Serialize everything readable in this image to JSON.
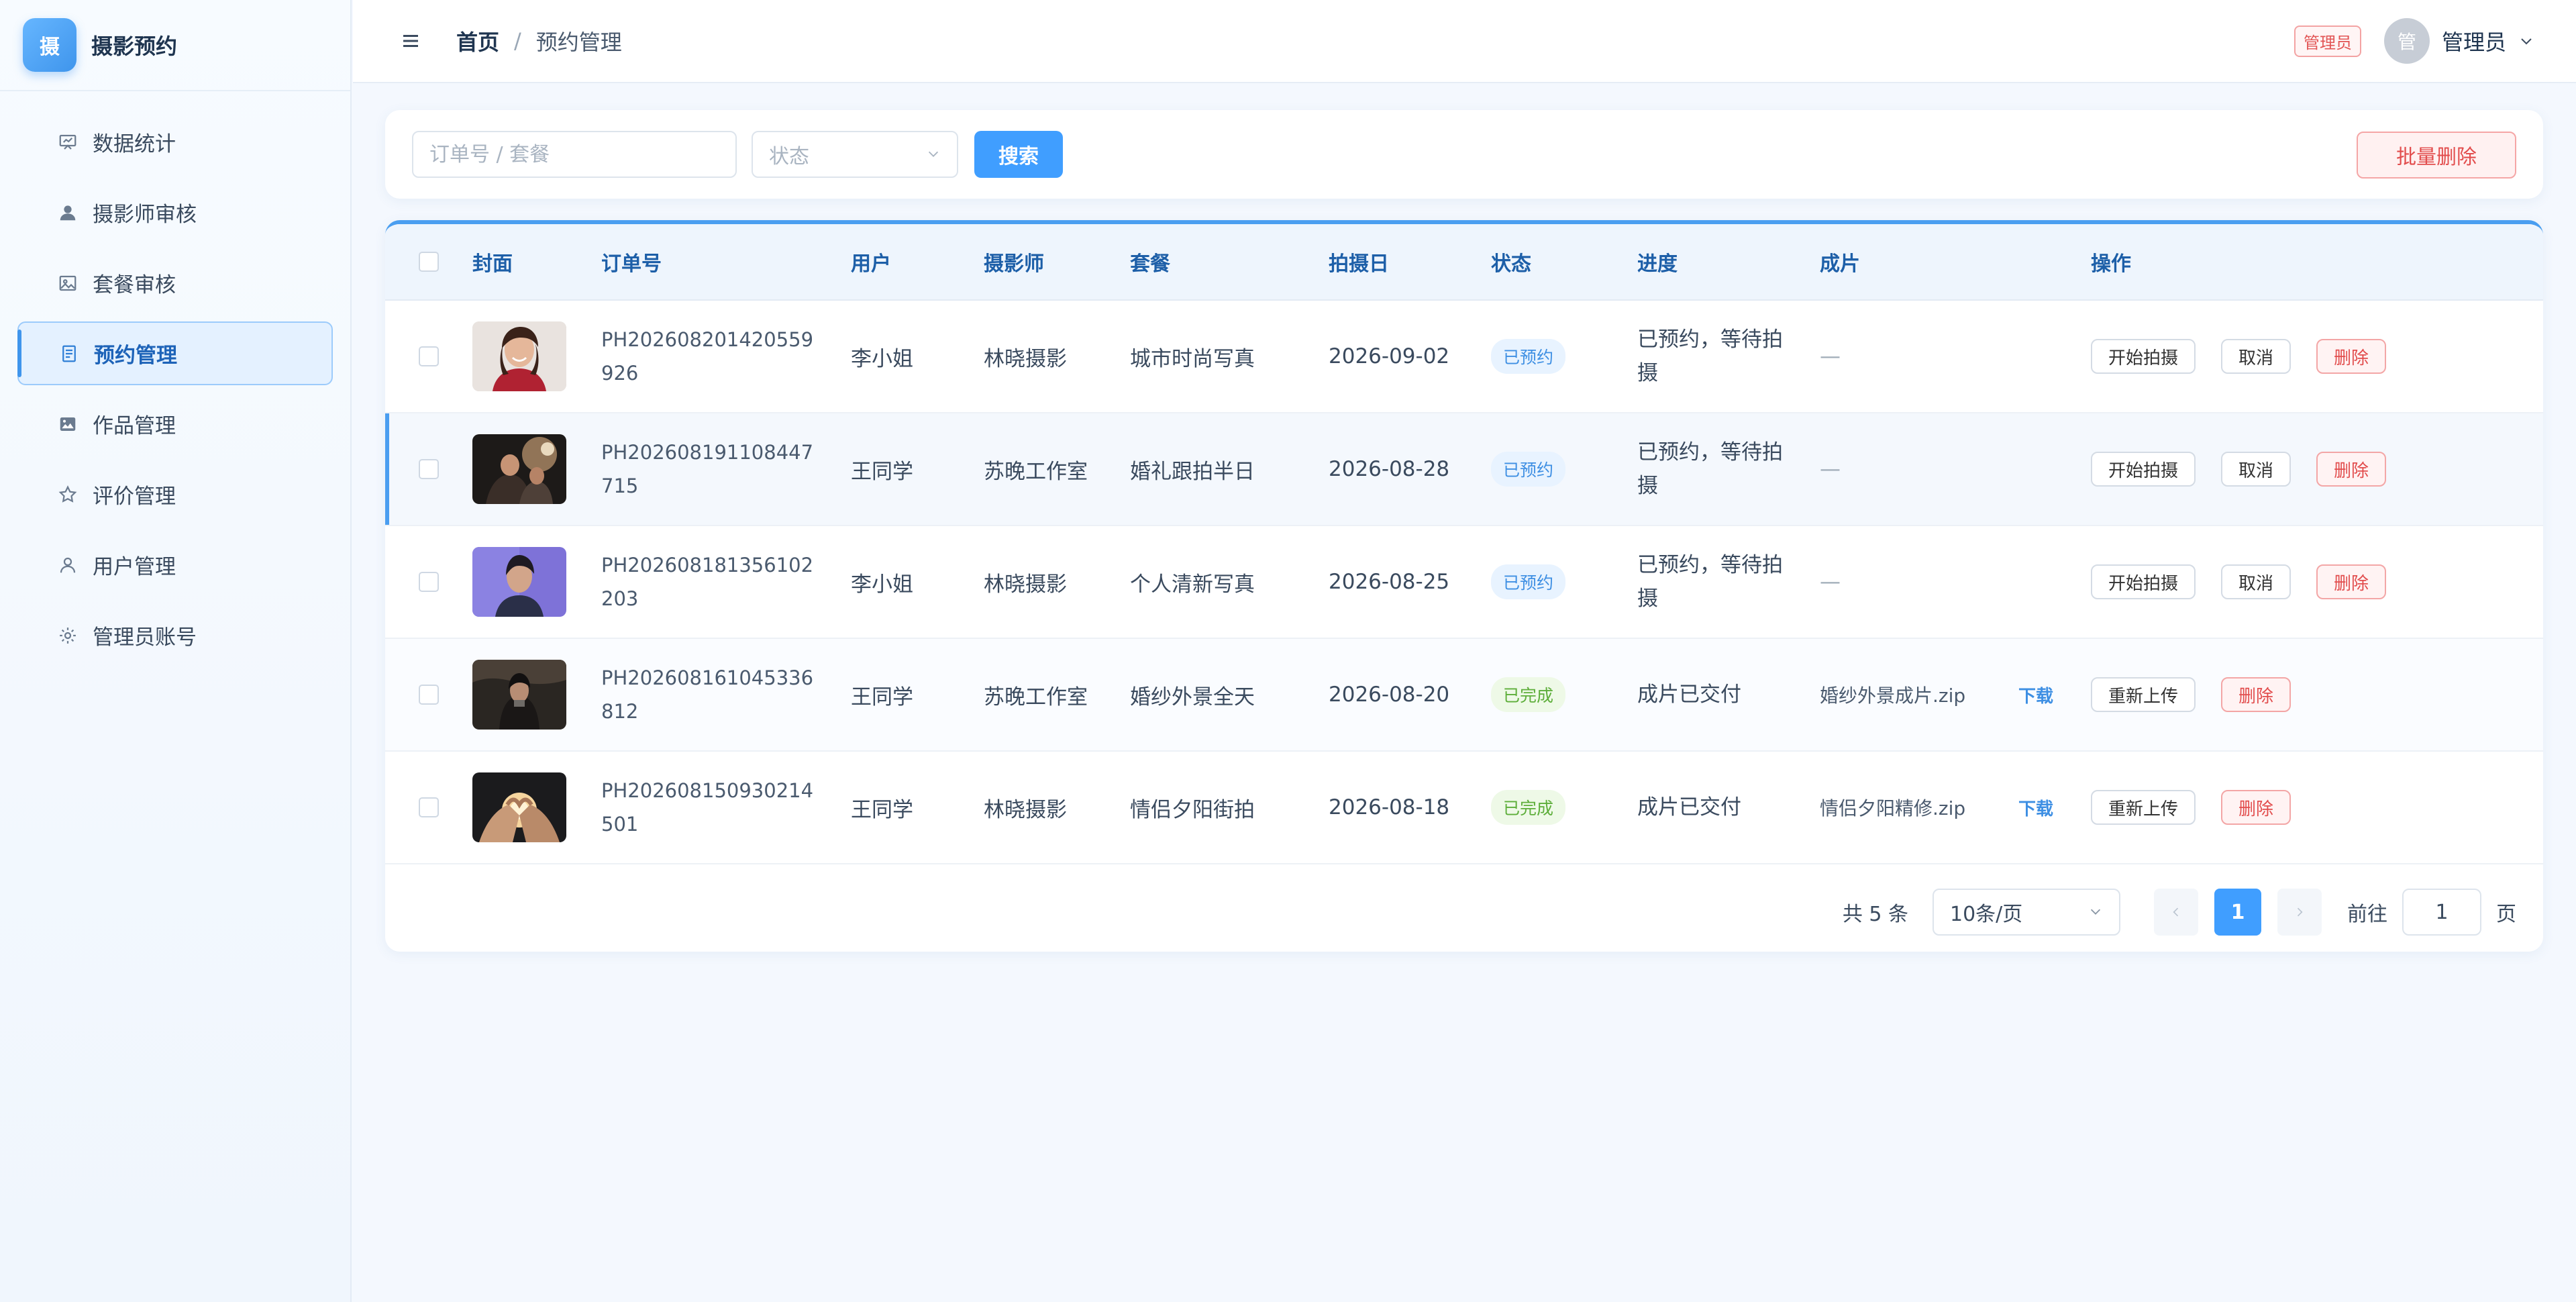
{
  "brand": {
    "logo_char": "摄",
    "name": "摄影预约"
  },
  "sidebar": {
    "items": [
      {
        "label": "数据统计",
        "icon": "chart-board-icon"
      },
      {
        "label": "摄影师审核",
        "icon": "person-icon"
      },
      {
        "label": "套餐审核",
        "icon": "image-icon"
      },
      {
        "label": "预约管理",
        "icon": "document-icon",
        "active": true
      },
      {
        "label": "作品管理",
        "icon": "gallery-icon"
      },
      {
        "label": "评价管理",
        "icon": "star-icon"
      },
      {
        "label": "用户管理",
        "icon": "user-icon"
      },
      {
        "label": "管理员账号",
        "icon": "gear-icon"
      }
    ]
  },
  "header": {
    "breadcrumb_home": "首页",
    "breadcrumb_sep": "/",
    "breadcrumb_current": "预约管理",
    "role_badge": "管理员",
    "avatar_char": "管",
    "user_name": "管理员"
  },
  "filters": {
    "search_placeholder": "订单号 / 套餐",
    "search_value": "",
    "status_placeholder": "状态",
    "search_button": "搜索",
    "batch_delete_button": "批量删除"
  },
  "table": {
    "columns": [
      "封面",
      "订单号",
      "用户",
      "摄影师",
      "套餐",
      "拍摄日",
      "状态",
      "进度",
      "成片",
      "操作"
    ],
    "rows": [
      {
        "order_no": "PH202608201420559926",
        "user": "李小姐",
        "photographer": "林晓摄影",
        "package": "城市时尚写真",
        "date": "2026-09-02",
        "status": "已预约",
        "progress": "已预约，等待拍摄",
        "result": "—",
        "download": "",
        "ops": [
          "开始拍摄",
          "取消",
          "删除"
        ]
      },
      {
        "order_no": "PH202608191108447715",
        "user": "王同学",
        "photographer": "苏晚工作室",
        "package": "婚礼跟拍半日",
        "date": "2026-08-28",
        "status": "已预约",
        "progress": "已预约，等待拍摄",
        "result": "—",
        "download": "",
        "ops": [
          "开始拍摄",
          "取消",
          "删除"
        ]
      },
      {
        "order_no": "PH202608181356102203",
        "user": "李小姐",
        "photographer": "林晓摄影",
        "package": "个人清新写真",
        "date": "2026-08-25",
        "status": "已预约",
        "progress": "已预约，等待拍摄",
        "result": "—",
        "download": "",
        "ops": [
          "开始拍摄",
          "取消",
          "删除"
        ]
      },
      {
        "order_no": "PH202608161045336812",
        "user": "王同学",
        "photographer": "苏晚工作室",
        "package": "婚纱外景全天",
        "date": "2026-08-20",
        "status": "已完成",
        "progress": "成片已交付",
        "result": "婚纱外景成片.zip",
        "download": "下载",
        "ops": [
          "重新上传",
          "删除"
        ]
      },
      {
        "order_no": "PH202608150930214501",
        "user": "王同学",
        "photographer": "林晓摄影",
        "package": "情侣夕阳街拍",
        "date": "2026-08-18",
        "status": "已完成",
        "progress": "成片已交付",
        "result": "情侣夕阳精修.zip",
        "download": "下载",
        "ops": [
          "重新上传",
          "删除"
        ]
      }
    ]
  },
  "pagination": {
    "total": "共 5 条",
    "page_size": "10条/页",
    "current_page": "1",
    "goto_label": "前往",
    "goto_value": "1",
    "goto_unit": "页"
  },
  "colors": {
    "primary": "#409eff",
    "danger": "#e24d4d",
    "success": "#5dae3a"
  }
}
